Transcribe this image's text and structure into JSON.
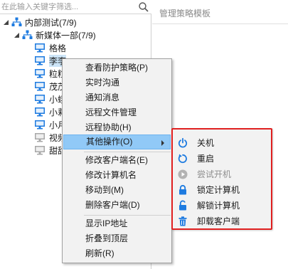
{
  "search": {
    "placeholder": "在此输入关键字筛选..."
  },
  "tree": {
    "root": {
      "label": "内部测试(7/9)"
    },
    "group": {
      "label": "新媒体一部(7/9)"
    },
    "computers": [
      {
        "label": "格格",
        "online": true
      },
      {
        "label": "李李",
        "online": true
      },
      {
        "label": "粒粒",
        "online": true
      },
      {
        "label": "茂茂",
        "online": true
      },
      {
        "label": "小蛾",
        "online": true
      },
      {
        "label": "小莉",
        "online": true
      },
      {
        "label": "小月",
        "online": true
      },
      {
        "label": "视频",
        "online": false
      },
      {
        "label": "甜甜",
        "online": false
      }
    ]
  },
  "right_panel": {
    "title": "管理策略模板"
  },
  "context_menu": {
    "items": [
      {
        "label": "查看防护策略(P)"
      },
      {
        "label": "实时沟通"
      },
      {
        "label": "通知消息"
      },
      {
        "label": "远程文件管理"
      },
      {
        "label": "远程协助(H)"
      },
      {
        "label": "其他操作(O)"
      },
      {
        "label": "修改客户端名(E)"
      },
      {
        "label": "修改计算机名"
      },
      {
        "label": "移动到(M)"
      },
      {
        "label": "删除客户端(D)"
      },
      {
        "label": "显示IP地址"
      },
      {
        "label": "折叠到顶层"
      },
      {
        "label": "刷新(R)"
      }
    ]
  },
  "submenu": {
    "items": [
      {
        "label": "关机",
        "icon": "power-icon",
        "enabled": true
      },
      {
        "label": "重启",
        "icon": "restart-icon",
        "enabled": true
      },
      {
        "label": "尝试开机",
        "icon": "play-icon",
        "enabled": false
      },
      {
        "label": "锁定计算机",
        "icon": "lock-icon",
        "enabled": true
      },
      {
        "label": "解锁计算机",
        "icon": "unlock-icon",
        "enabled": true
      },
      {
        "label": "卸载客户端",
        "icon": "trash-icon",
        "enabled": true
      }
    ]
  },
  "colors": {
    "accent_blue": "#1e7be0",
    "menu_highlight": "#91c9f7",
    "submenu_border": "#e02020",
    "disabled_text": "#8e8e8e"
  }
}
